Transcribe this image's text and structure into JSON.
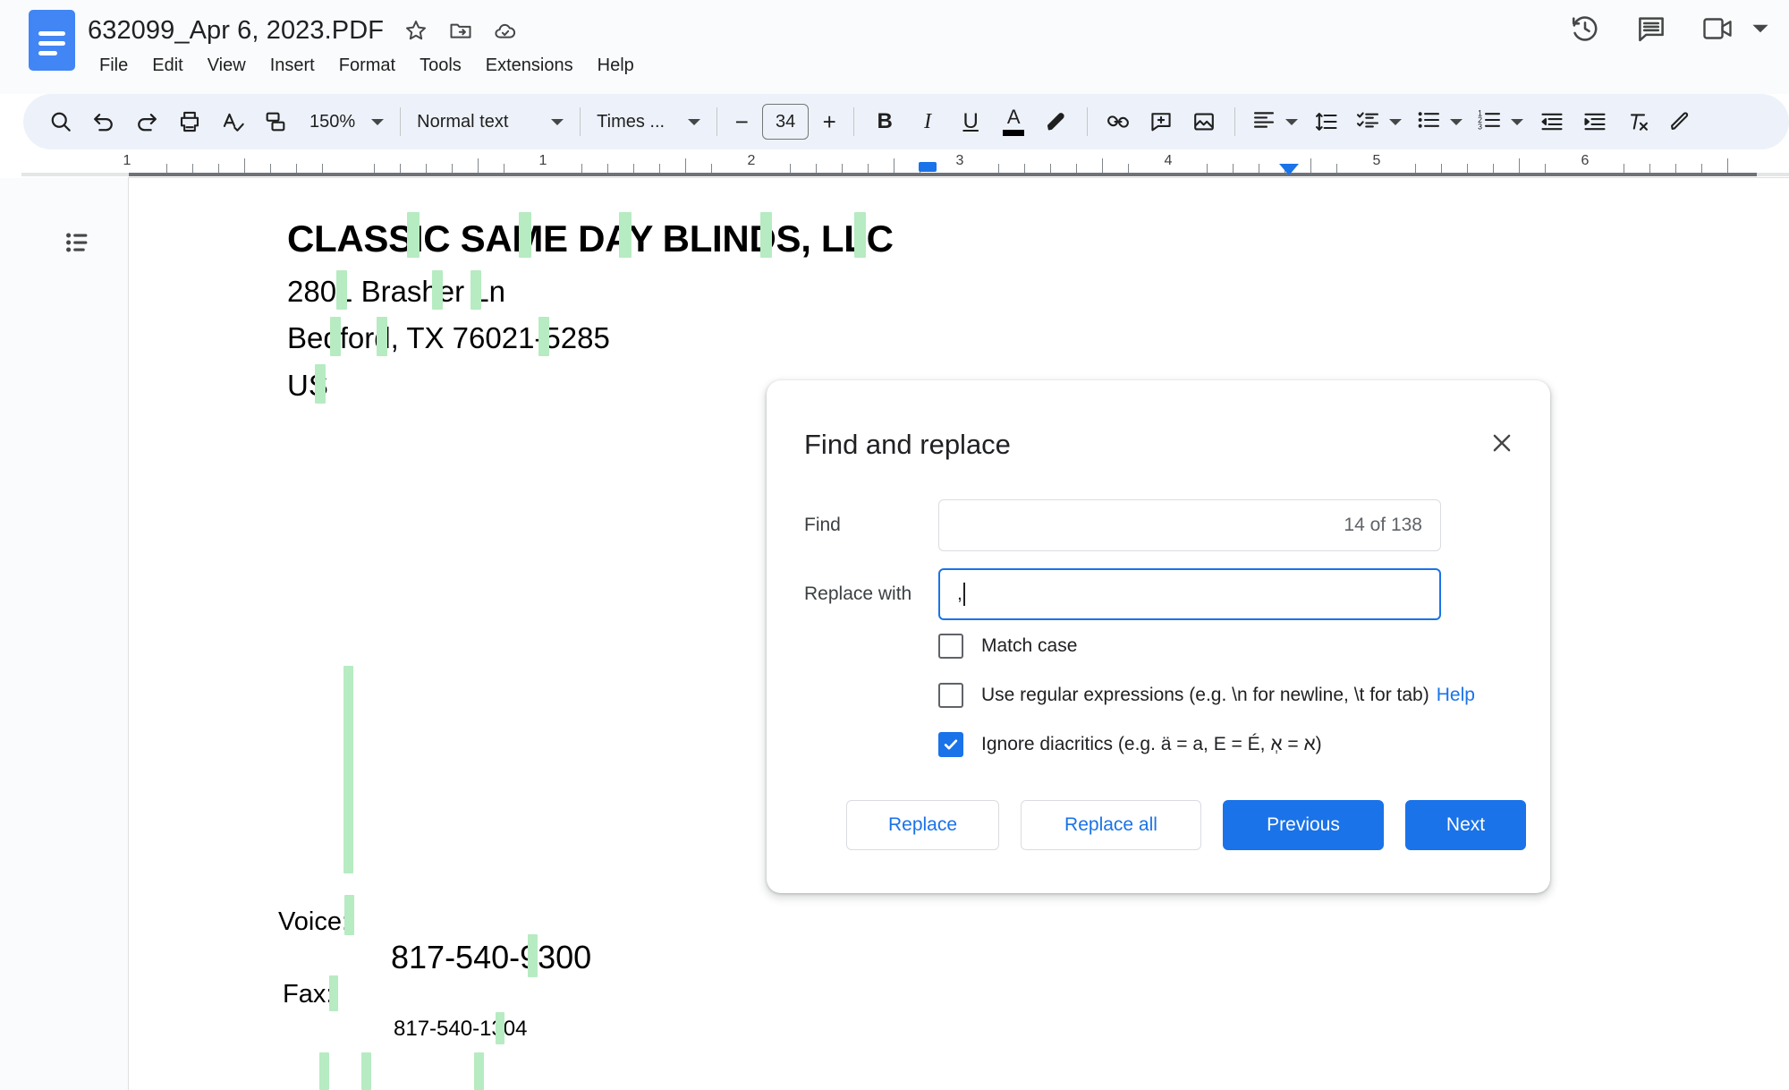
{
  "app": {
    "name": "Google Docs",
    "logo_icon": "docs-logo-icon"
  },
  "header": {
    "doc_title": "632099_Apr 6, 2023.PDF",
    "title_icons": [
      {
        "name": "star-icon",
        "label": "Star"
      },
      {
        "name": "move-to-folder-icon",
        "label": "Move"
      },
      {
        "name": "cloud-saved-icon",
        "label": "Saved to Drive"
      }
    ],
    "menu": [
      {
        "label": "File"
      },
      {
        "label": "Edit"
      },
      {
        "label": "View"
      },
      {
        "label": "Insert"
      },
      {
        "label": "Format"
      },
      {
        "label": "Tools"
      },
      {
        "label": "Extensions"
      },
      {
        "label": "Help"
      }
    ],
    "right_icons": [
      {
        "name": "version-history-icon",
        "label": "Version history"
      },
      {
        "name": "comment-history-icon",
        "label": "Open comment history"
      },
      {
        "name": "video-call-icon",
        "label": "Join a call"
      },
      {
        "name": "video-call-caret-icon",
        "label": "Call options"
      }
    ]
  },
  "toolbar": {
    "search_icon": "search-icon",
    "undo_icon": "undo-icon",
    "redo_icon": "redo-icon",
    "print_icon": "print-icon",
    "spellcheck_icon": "spellcheck-icon",
    "paint_format_icon": "paint-format-icon",
    "zoom_level": "150%",
    "paragraph_style": "Normal text",
    "font_family": "Times ...",
    "font_size": "34",
    "decrease_font_label": "−",
    "increase_font_label": "+",
    "bold_label": "B",
    "italic_label": "I",
    "underline_label": "U",
    "text_color_label": "A",
    "highlight_icon": "highlight-pen-icon",
    "link_icon": "insert-link-icon",
    "add_comment_icon": "add-comment-icon",
    "insert_image_icon": "insert-image-icon",
    "align_icon": "align-left-icon",
    "line_spacing_icon": "line-spacing-icon",
    "checklist_icon": "checklist-icon",
    "bulleted_list_icon": "bulleted-list-icon",
    "numbered_list_icon": "numbered-list-icon",
    "decrease_indent_icon": "decrease-indent-icon",
    "increase_indent_icon": "increase-indent-icon",
    "clear_formatting_icon": "clear-formatting-icon",
    "editing_mode_icon": "editing-mode-icon"
  },
  "ruler": {
    "numbers": [
      "1",
      "1",
      "2",
      "3",
      "4",
      "5",
      "6"
    ],
    "left_indent_marker": "left-indent-marker",
    "right_indent_marker": "right-indent-marker"
  },
  "document": {
    "outline_icon": "document-outline-icon",
    "lines": [
      {
        "text": "CLASSIC SAME DAY BLINDS, LLC",
        "style": "heading"
      },
      {
        "text": "2801 Brasher Ln",
        "style": "body"
      },
      {
        "text": "Bedford, TX 76021-5285",
        "style": "body"
      },
      {
        "text": "US",
        "style": "body"
      },
      {
        "text": "Voice:",
        "style": "small"
      },
      {
        "text": "817-540-9300",
        "style": "body"
      },
      {
        "text": "Fax:",
        "style": "small"
      },
      {
        "text": "817-540-1304",
        "style": "tiny"
      }
    ],
    "highlight_color": "#b7ebc2"
  },
  "dialog": {
    "title": "Find and replace",
    "close_icon": "close-icon",
    "find": {
      "label": "Find",
      "value": "",
      "match_count": "14 of 138"
    },
    "replace": {
      "label": "Replace with",
      "value": ",",
      "focused": true
    },
    "options": [
      {
        "label": "Match case",
        "checked": false,
        "name": "match-case-checkbox"
      },
      {
        "label": "Use regular expressions (e.g. \\n for newline, \\t for tab)",
        "link": "Help",
        "checked": false,
        "name": "use-regex-checkbox"
      },
      {
        "label": "Ignore diacritics (e.g. ä = a, E = É, א = אְ)",
        "checked": true,
        "name": "ignore-diacritics-checkbox"
      }
    ],
    "buttons": [
      {
        "label": "Replace",
        "kind": "outline",
        "name": "replace-button"
      },
      {
        "label": "Replace all",
        "kind": "outline",
        "name": "replace-all-button"
      },
      {
        "label": "Previous",
        "kind": "filled",
        "name": "previous-button"
      },
      {
        "label": "Next",
        "kind": "filled",
        "name": "next-button"
      }
    ]
  },
  "colors": {
    "accent": "#1a73e8",
    "toolbar_bg": "#edf2fa",
    "header_bg": "#f9fbfd",
    "highlight": "#b7ebc2"
  }
}
